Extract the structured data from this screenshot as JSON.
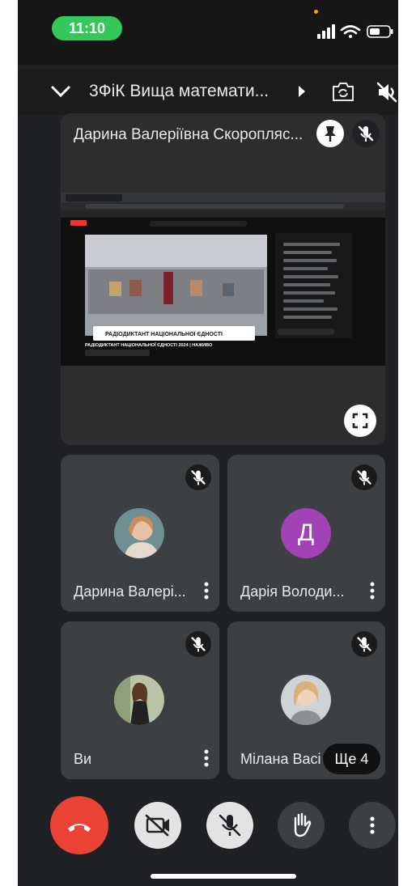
{
  "status_bar": {
    "time": "11:10",
    "icons": [
      "signal-icon",
      "wifi-icon",
      "battery-icon"
    ]
  },
  "top_bar": {
    "title": "3ФіК Вища математи...",
    "icons": [
      "chevron-down-icon",
      "chevron-right-icon",
      "camera-flip-icon",
      "speaker-off-icon"
    ]
  },
  "main_tile": {
    "name": "Дарина Валеріївна Скоропляс...",
    "icons": [
      "pin-icon",
      "mic-off-icon",
      "fullscreen-icon"
    ],
    "shared_screen": {
      "video_title": "РАДІОДИКТАНТ НАЦІОНАЛЬНОЇ ЄДНОСТІ 2024 | НАЖИВО",
      "banner_text": "РАДІОДИКТАНТ НАЦІОНАЛЬНОЇ ЄДНОСТІ"
    }
  },
  "participants": [
    {
      "name": "Дарина Валері...",
      "avatar": "photo"
    },
    {
      "name": "Дарія Володи...",
      "avatar": "letter",
      "letter": "Д",
      "color": "#a142b5"
    },
    {
      "name": "Ви",
      "avatar": "photo"
    },
    {
      "name": "Мілана Васі",
      "avatar": "photo"
    }
  ],
  "more_participants": "Ще 4",
  "controls": [
    "end-call-icon",
    "camera-off-icon",
    "mic-off-icon",
    "raise-hand-icon",
    "more-vert-icon"
  ],
  "colors": {
    "background": "#202124",
    "tile": "#3c4043",
    "end_call": "#ea4335",
    "status_time": "#34c759"
  }
}
